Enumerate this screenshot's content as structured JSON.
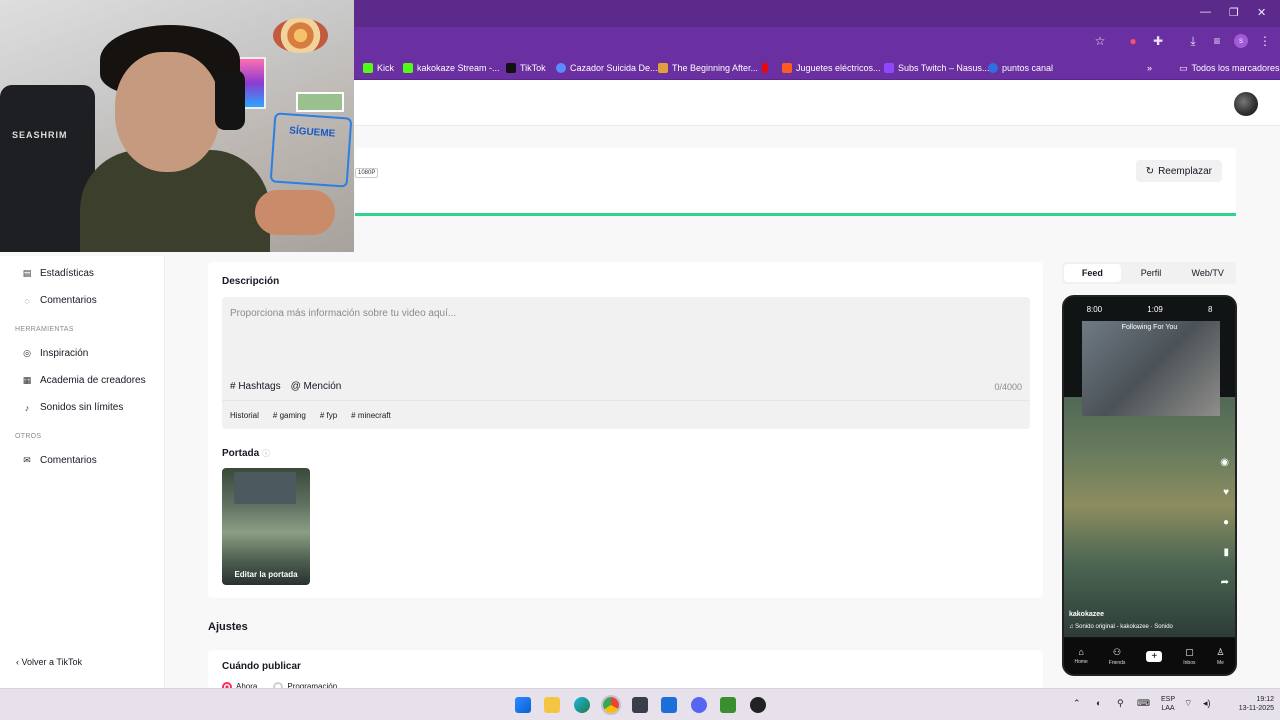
{
  "browser": {
    "window_controls": [
      "—",
      "❐",
      "✕"
    ],
    "bookmarks": [
      {
        "label": "Kick",
        "color": "#53fc18"
      },
      {
        "label": "kakokaze Stream -...",
        "color": "#53fc18"
      },
      {
        "label": "TikTok",
        "color": "#000000"
      },
      {
        "label": "Cazador Suicida De...",
        "color": "#5b8cff"
      },
      {
        "label": "The Beginning After...",
        "color": "#e0a040"
      },
      {
        "label": "",
        "color": "#e50914"
      },
      {
        "label": "Juguetes eléctricos...",
        "color": "#ff5a1f"
      },
      {
        "label": "Subs Twitch – Nasus...",
        "color": "#9146ff"
      },
      {
        "label": "puntos canal",
        "color": "#2f6fe0"
      }
    ],
    "all_bookmarks": "Todos los marcadores"
  },
  "upload": {
    "resolution": "1080P",
    "replace_button": "Reemplazar"
  },
  "sidebar": {
    "items_top": [
      {
        "label": "Estadísticas",
        "icon": "▤"
      },
      {
        "label": "Comentarios",
        "icon": "◌"
      }
    ],
    "section_tools": "HERRAMIENTAS",
    "items_tools": [
      {
        "label": "Inspiración",
        "icon": "◎"
      },
      {
        "label": "Academia de creadores",
        "icon": "▦"
      },
      {
        "label": "Sonidos sin límites",
        "icon": "♪"
      }
    ],
    "section_other": "OTROS",
    "items_other": [
      {
        "label": "Comentarios",
        "icon": "✉"
      }
    ],
    "back": "‹  Volver a TikTok"
  },
  "description": {
    "label": "Descripción",
    "placeholder": "Proporciona más información sobre tu video aquí...",
    "hashtags": "# Hashtags",
    "mention": "@ Mención",
    "counter": "0/4000",
    "tags": [
      "Historial",
      "# gaming",
      "# fyp",
      "# minecraft"
    ]
  },
  "cover": {
    "label": "Portada",
    "edit": "Editar la portada"
  },
  "settings": {
    "title": "Ajustes",
    "when_label": "Cuándo publicar",
    "now": "Ahora",
    "schedule": "Programación"
  },
  "preview": {
    "tabs": [
      "Feed",
      "Perfil",
      "Web/TV"
    ],
    "status_time": "1:09",
    "status_left": "8:00",
    "status_right": "8",
    "top_tabs": "Following   For You",
    "username": "kakokazee",
    "sound": "♫ Sonido original - kakokazee · Sonido",
    "nav": [
      {
        "icon": "⌂",
        "label": "Home"
      },
      {
        "icon": "⚇",
        "label": "Friends"
      },
      {
        "icon": "+",
        "label": ""
      },
      {
        "icon": "▢",
        "label": "Inbox"
      },
      {
        "icon": "♙",
        "label": "Me"
      }
    ]
  },
  "webcam": {
    "sign_text": "SÍGUEME",
    "chair_logo": "SEASHRIM"
  },
  "taskbar": {
    "lang": "ESP",
    "lang2": "LAA",
    "time": "19:12",
    "date": "13-11-2025"
  }
}
